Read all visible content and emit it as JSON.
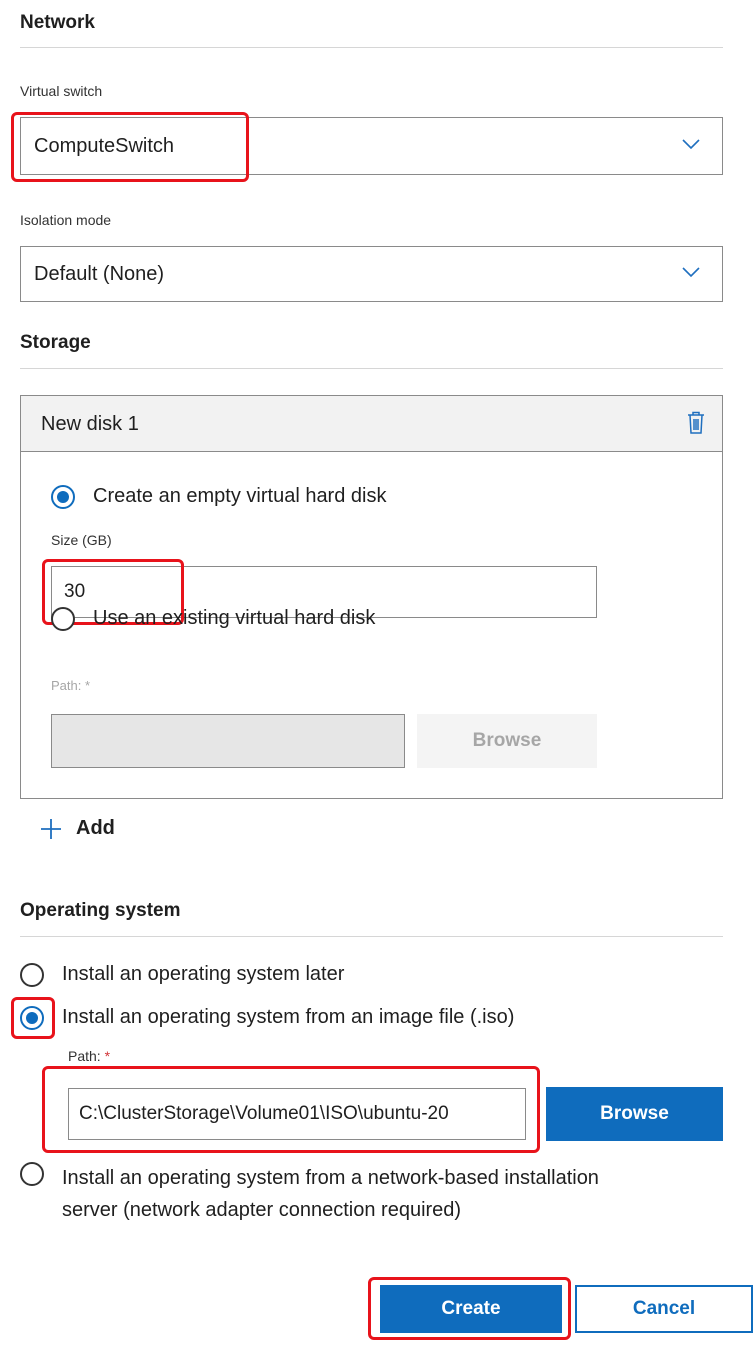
{
  "network": {
    "title": "Network",
    "virtual_switch_label": "Virtual switch",
    "virtual_switch_value": "ComputeSwitch",
    "isolation_mode_label": "Isolation mode",
    "isolation_mode_value": "Default (None)"
  },
  "storage": {
    "title": "Storage",
    "disk_title": "New disk 1",
    "option_empty": "Create an empty virtual hard disk",
    "size_label": "Size (GB)",
    "size_value": "30",
    "option_existing": "Use an existing virtual hard disk",
    "path_label": "Path:",
    "path_required": "*",
    "path_value": "",
    "browse_label": "Browse",
    "add_label": "Add"
  },
  "os": {
    "title": "Operating system",
    "option_later": "Install an operating system later",
    "option_iso": "Install an operating system from an image file (.iso)",
    "path_label": "Path:",
    "path_required": "*",
    "path_value": "C:\\ClusterStorage\\Volume01\\ISO\\ubuntu-20",
    "browse_label": "Browse",
    "option_network_line1": "Install an operating system from a network-based installation",
    "option_network_line2": "server (network adapter connection required)"
  },
  "footer": {
    "create_label": "Create",
    "cancel_label": "Cancel"
  },
  "colors": {
    "accent": "#0f6cbd",
    "highlight": "#e8131b",
    "required": "#d13438"
  },
  "icons": {
    "trash": "trash-icon",
    "chevron": "chevron-down-icon",
    "plus": "plus-icon"
  }
}
